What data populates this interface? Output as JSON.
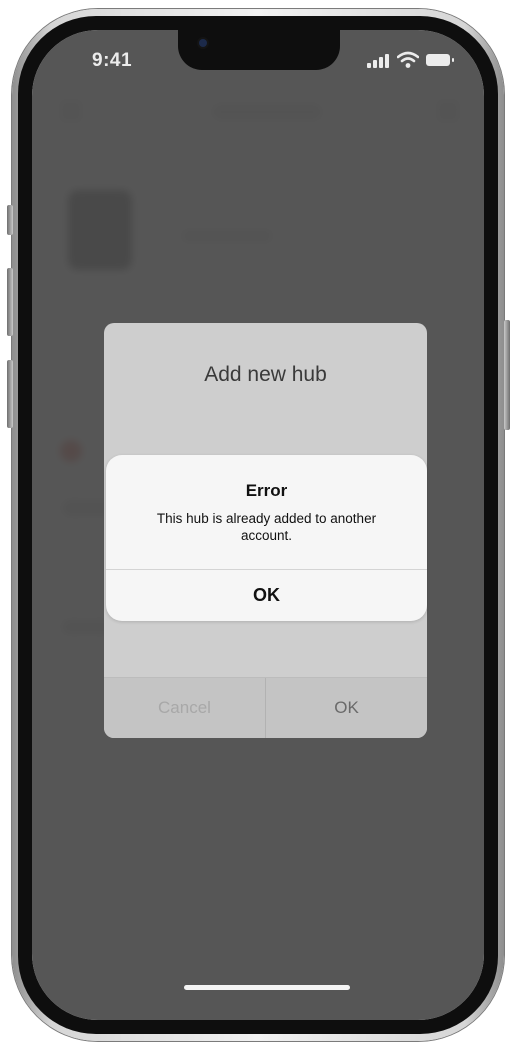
{
  "status_bar": {
    "time": "9:41",
    "icons": [
      "signal-icon",
      "wifi-icon",
      "battery-icon"
    ]
  },
  "hub_dialog": {
    "title": "Add new hub",
    "cancel_label": "Cancel",
    "ok_label": "OK"
  },
  "error_alert": {
    "title": "Error",
    "message": "This hub is already added to another account.",
    "ok_label": "OK"
  },
  "colors": {
    "overlay": "#4a4a4a",
    "alert_background": "#f6f6f6",
    "dialog_background": "#cecece"
  }
}
